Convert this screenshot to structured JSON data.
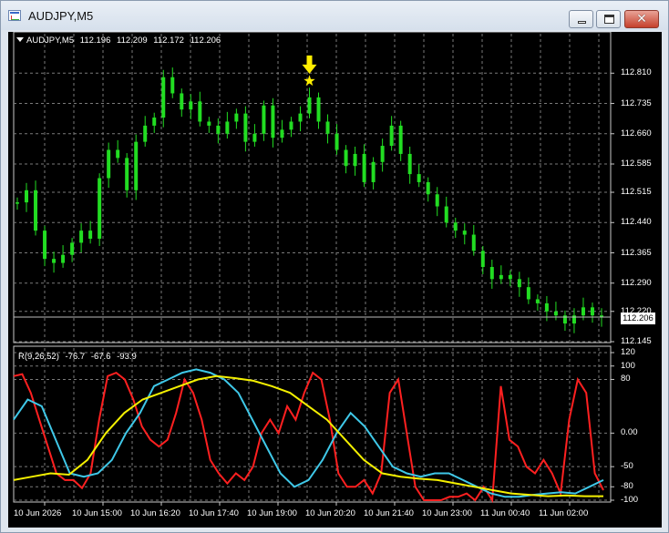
{
  "window": {
    "title": "AUDJPY,M5",
    "close_glyph": "✕",
    "icons": [
      "app-chart-icon",
      "minimize-icon",
      "maximize-icon",
      "close-icon"
    ]
  },
  "symbol_info": {
    "symbol": "AUDJPY,M5",
    "open": "112.196",
    "high": "112.209",
    "low": "112.172",
    "close": "112.206"
  },
  "indicator_info": {
    "name": "R(9,26,52)",
    "v1": "-76.7",
    "v2": "-67.6",
    "v3": "-93.9"
  },
  "current_price": "112.206",
  "colors": {
    "background": "#000000",
    "grid": "#7a7a7a",
    "candles": "#22dd22",
    "series_red": "#ff2020",
    "series_cyan": "#3fc8e8",
    "series_yellow": "#f4f000",
    "marker": "#ffee00"
  },
  "chart_data": [
    {
      "type": "line",
      "series": [
        {
          "values": [
            112.49,
            112.52,
            112.42,
            112.35,
            112.34,
            112.36,
            112.39,
            112.42,
            112.4,
            112.55,
            112.62,
            112.6,
            112.52,
            112.64,
            112.68,
            112.7,
            112.8,
            112.76,
            112.72,
            112.74,
            112.69,
            112.68,
            112.66,
            112.69,
            112.71,
            112.64,
            112.66,
            112.73,
            112.65,
            112.67,
            112.69,
            112.71,
            112.75,
            112.69,
            112.66,
            112.62,
            112.58,
            112.61,
            112.54,
            112.59,
            112.63,
            112.68,
            112.61,
            112.56,
            112.54,
            112.51,
            112.48,
            112.44,
            112.42,
            112.41,
            112.37,
            112.33,
            112.3,
            112.31,
            112.3,
            112.28,
            112.25,
            112.24,
            112.22,
            112.21,
            112.19,
            112.21,
            112.23,
            112.21,
            112.206
          ]
        }
      ],
      "y_ticks": [
        "112.810",
        "112.735",
        "112.660",
        "112.585",
        "112.515",
        "112.440",
        "112.365",
        "112.290",
        "112.220",
        "112.145"
      ],
      "ylim": [
        112.145,
        112.84
      ],
      "grid": true
    },
    {
      "type": "line",
      "series": [
        {
          "color": "red",
          "values": [
            85,
            88,
            60,
            20,
            -20,
            -60,
            -70,
            -70,
            -82,
            -60,
            20,
            85,
            90,
            80,
            50,
            10,
            -10,
            -20,
            -10,
            30,
            80,
            60,
            20,
            -40,
            -60,
            -75,
            -60,
            -70,
            -50,
            0,
            20,
            0,
            40,
            20,
            60,
            90,
            80,
            20,
            -60,
            -80,
            -80,
            -70,
            -90,
            -60,
            60,
            80,
            0,
            -80,
            -100,
            -100,
            -100,
            -95,
            -95,
            -90,
            -100,
            -80,
            -100,
            70,
            -10,
            -20,
            -50,
            -60,
            -40,
            -60,
            -90,
            20,
            80,
            60,
            -60,
            -85
          ]
        },
        {
          "color": "cyan",
          "values": [
            20,
            50,
            40,
            -10,
            -60,
            -65,
            -60,
            -40,
            0,
            30,
            70,
            80,
            90,
            95,
            90,
            80,
            60,
            20,
            -20,
            -60,
            -80,
            -70,
            -40,
            0,
            30,
            10,
            -20,
            -50,
            -60,
            -65,
            -60,
            -60,
            -70,
            -80,
            -90,
            -95,
            -95,
            -92,
            -90,
            -88,
            -90,
            -80,
            -70
          ]
        },
        {
          "color": "yellow",
          "values": [
            -70,
            -65,
            -60,
            -62,
            -40,
            0,
            30,
            50,
            60,
            70,
            80,
            85,
            82,
            78,
            70,
            60,
            40,
            20,
            -10,
            -40,
            -60,
            -65,
            -68,
            -70,
            -75,
            -80,
            -85,
            -90,
            -92,
            -94,
            -93,
            -94,
            -94
          ]
        }
      ],
      "y_ticks": [
        "120",
        "100",
        "80",
        "0.00",
        "-50",
        "-80",
        "-100"
      ],
      "ylim": [
        -100,
        120
      ],
      "grid": true
    }
  ],
  "time_labels": [
    "10 Jun 2026",
    "10 Jun 15:00",
    "10 Jun 16:20",
    "10 Jun 17:40",
    "10 Jun 19:00",
    "10 Jun 20:20",
    "10 Jun 21:40",
    "10 Jun 23:00",
    "11 Jun 00:40",
    "11 Jun 02:00"
  ]
}
